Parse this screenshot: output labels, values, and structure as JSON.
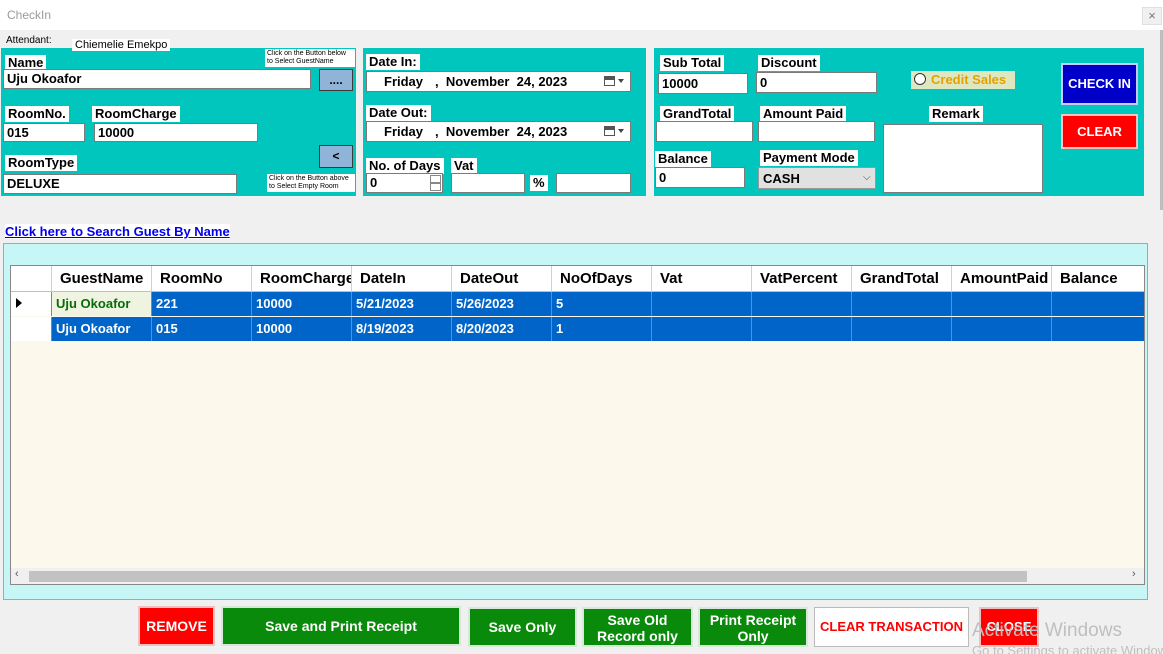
{
  "window": {
    "title": "CheckIn",
    "close_glyph": "×"
  },
  "attendant": {
    "label": "Attendant:",
    "name": "Chiemelie Emekpo"
  },
  "guest": {
    "name_label": "Name",
    "name_value": "Uju Okoafor",
    "select_guest_hint": "Click on the Button below to Select GuestName",
    "select_guest_button": "....",
    "room_no_label": "RoomNo.",
    "room_no_value": "015",
    "room_charge_label": "RoomCharge",
    "room_charge_value": "10000",
    "room_type_label": "RoomType",
    "room_type_value": "DELUXE",
    "select_room_button": "<",
    "select_room_hint": "Click on the Button above to Select Empty Room"
  },
  "dates": {
    "date_in_label": "Date In:",
    "date_in_day": "Friday",
    "date_in_date": ",  November  24, 2023",
    "date_out_label": "Date Out:",
    "date_out_day": "Friday",
    "date_out_date": ",  November  24, 2023",
    "days_label": "No. of Days",
    "days_value": "0",
    "vat_label": "Vat",
    "vat_value": "",
    "percent_symbol": "%",
    "vat_percent_value": ""
  },
  "billing": {
    "subtotal_label": "Sub Total",
    "subtotal_value": "10000",
    "discount_label": "Discount",
    "discount_value": "0",
    "credit_sales_label": "Credit Sales",
    "grandtotal_label": "GrandTotal",
    "grandtotal_value": "",
    "amount_paid_label": "Amount Paid",
    "amount_paid_value": "",
    "remark_label": "Remark",
    "remark_value": "",
    "balance_label": "Balance",
    "balance_value": "0",
    "payment_mode_label": "Payment Mode",
    "payment_mode_value": "CASH"
  },
  "actions": {
    "check_in": "CHECK IN",
    "clear": "CLEAR"
  },
  "search_link": "Click here to Search Guest By Name ",
  "table": {
    "columns": [
      "GuestName",
      "RoomNo",
      "RoomCharge",
      "DateIn",
      "DateOut",
      "NoOfDays",
      "Vat",
      "VatPercent",
      "GrandTotal",
      "AmountPaid",
      "Balance"
    ],
    "rows": [
      [
        "Uju Okoafor",
        "221",
        "10000",
        "5/21/2023",
        "5/26/2023",
        "5",
        "",
        "",
        "",
        "",
        ""
      ],
      [
        "Uju Okoafor",
        "015",
        "10000",
        "8/19/2023",
        "8/20/2023",
        "1",
        "",
        "",
        "",
        "",
        ""
      ]
    ]
  },
  "footer": {
    "remove": "REMOVE",
    "save_print": "Save and Print Receipt",
    "save_only": "Save Only",
    "save_old_1": "Save Old",
    "save_old_2": "Record only",
    "print_only_1": "Print Receipt",
    "print_only_2": "Only",
    "clear_transaction": "CLEAR TRANSACTION",
    "close": "CLOSE"
  },
  "watermark": {
    "line1": "Activate Windows",
    "line2": "Go to Settings to activate Windows."
  },
  "colors": {
    "panel": "#00c6be",
    "selected_row": "#0064c8",
    "credit_sales": "#e8a000",
    "check_in_bg": "#0000c8",
    "danger": "#ff0000",
    "save_green": "#0a8a0a"
  }
}
